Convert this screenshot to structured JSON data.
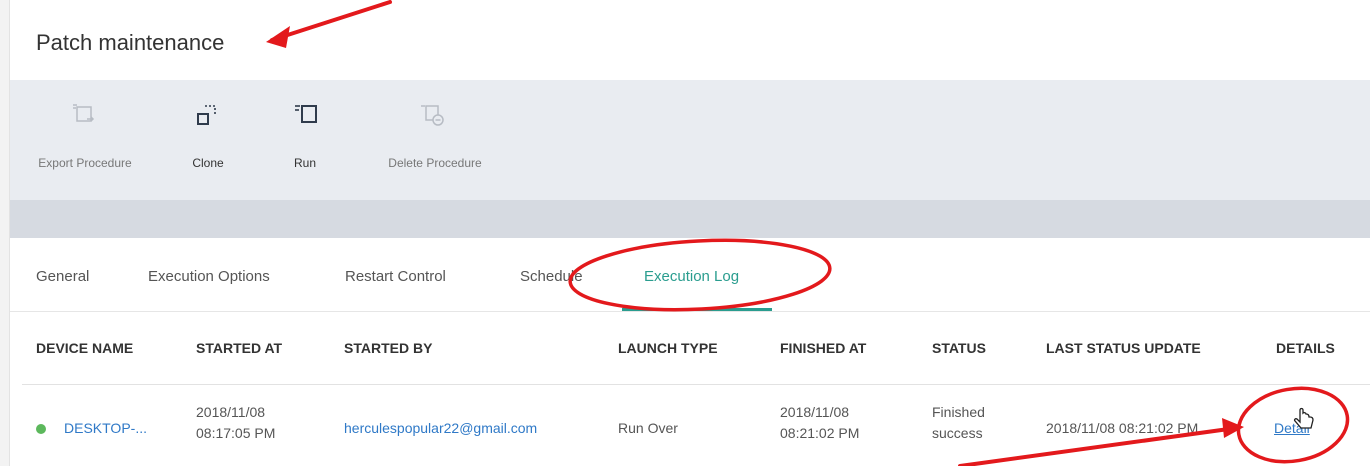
{
  "header": {
    "title": "Patch maintenance"
  },
  "toolbar": {
    "items": [
      {
        "label": "Export Procedure",
        "icon": "export-procedure-icon",
        "enabled": false
      },
      {
        "label": "Clone",
        "icon": "clone-icon",
        "enabled": true
      },
      {
        "label": "Run",
        "icon": "run-icon",
        "enabled": true
      },
      {
        "label": "Delete Procedure",
        "icon": "delete-procedure-icon",
        "enabled": false
      }
    ]
  },
  "tabs": [
    {
      "label": "General",
      "active": false
    },
    {
      "label": "Execution Options",
      "active": false
    },
    {
      "label": "Restart Control",
      "active": false
    },
    {
      "label": "Schedule",
      "active": false
    },
    {
      "label": "Execution Log",
      "active": true
    }
  ],
  "table": {
    "columns": [
      "DEVICE NAME",
      "STARTED AT",
      "STARTED BY",
      "LAUNCH TYPE",
      "FINISHED AT",
      "STATUS",
      "LAST STATUS UPDATE",
      "DETAILS"
    ],
    "rows": [
      {
        "device_name": "DESKTOP-...",
        "started_at_date": "2018/11/08",
        "started_at_time": "08:17:05 PM",
        "started_by": "herculespopular22@gmail.com",
        "launch_type": "Run Over",
        "finished_at_date": "2018/11/08",
        "finished_at_time": "08:21:02 PM",
        "status_line1": "Finished",
        "status_line2": "success",
        "last_status_update": "2018/11/08 08:21:02 PM",
        "details": "Detail"
      }
    ]
  },
  "colors": {
    "accent": "#2a9d8f",
    "link": "#2f79c7",
    "status_ok": "#5cb85c",
    "annotation": "#e3191c"
  }
}
